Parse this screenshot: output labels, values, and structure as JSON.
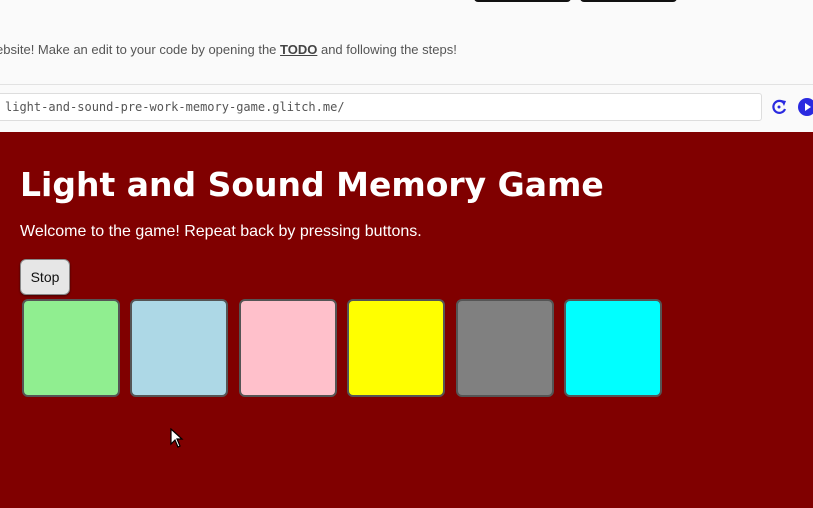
{
  "banner": {
    "text_before": "ebsite! Make an edit to your code by opening the ",
    "link": "TODO",
    "text_after": " and following the steps!"
  },
  "address_bar": {
    "url": "light-and-sound-pre-work-memory-game.glitch.me/"
  },
  "icons": {
    "refresh": "refresh-icon",
    "play": "play-icon",
    "cursor": "mouse-cursor-icon"
  },
  "game": {
    "title": "Light and Sound Memory Game",
    "welcome": "Welcome to the game! Repeat back by pressing buttons.",
    "stop_label": "Stop",
    "background_color": "#800000",
    "pads": [
      {
        "color": "#90ee90"
      },
      {
        "color": "#add8e6"
      },
      {
        "color": "#ffc0cb"
      },
      {
        "color": "#ffff00"
      },
      {
        "color": "#808080"
      },
      {
        "color": "#00ffff"
      }
    ]
  }
}
